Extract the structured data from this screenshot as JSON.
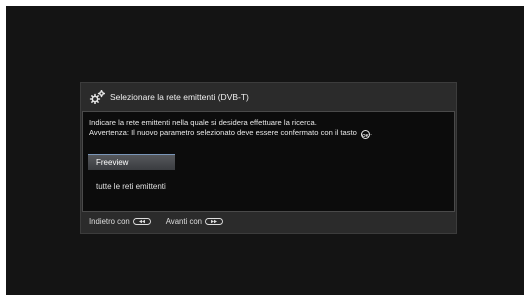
{
  "dialog": {
    "title": "Selezionare la rete emittenti (DVB-T)",
    "title_icon": "gears-icon",
    "description_line1": "Indicare la rete emittenti nella quale si desidera effettuare la ricerca.",
    "description_line2": "Avvertenza: Il nuovo parametro selezionato deve essere confermato con il tasto",
    "ok_key_label": "OK",
    "ok_key_icon": "ok-button-icon",
    "period": ".",
    "options": [
      {
        "label": "Freeview",
        "selected": true
      },
      {
        "label": "tutte le reti emittenti",
        "selected": false
      }
    ]
  },
  "footer": {
    "back_label": "Indietro con",
    "back_icon": "rewind-key-icon",
    "forward_label": "Avanti con",
    "forward_icon": "forward-key-icon"
  },
  "colors": {
    "screen_bg": "#141414",
    "dialog_bg": "#2b2b2b",
    "content_bg": "#0c0c0c",
    "selection_accent": "#7a96b8"
  }
}
